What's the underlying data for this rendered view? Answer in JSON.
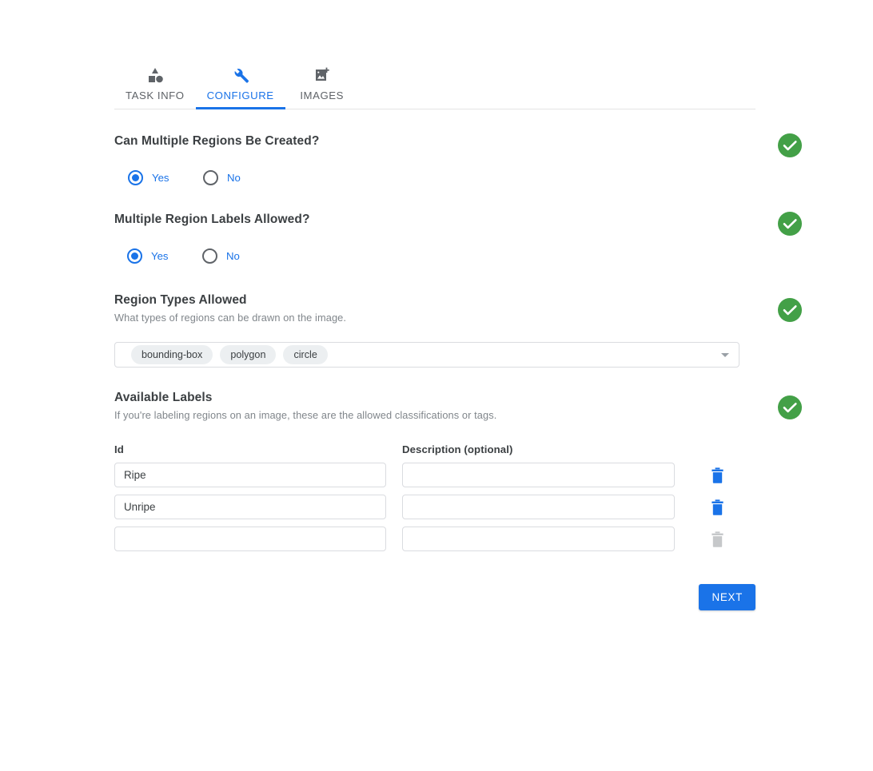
{
  "tabs": [
    {
      "label": "TASK INFO",
      "icon": "shapes-icon",
      "active": false
    },
    {
      "label": "CONFIGURE",
      "icon": "wrench-icon",
      "active": true
    },
    {
      "label": "IMAGES",
      "icon": "add-image-icon",
      "active": false
    }
  ],
  "colors": {
    "accent_blue": "#1a73e8",
    "valid_green": "#43a047",
    "chip_gray": "#eceff1",
    "border_gray": "#dadce0",
    "text_primary": "#3c4043",
    "text_muted": "#80868b"
  },
  "sections": {
    "multiple_regions": {
      "title": "Can Multiple Regions Be Created?",
      "valid": true,
      "options": [
        {
          "label": "Yes",
          "checked": true
        },
        {
          "label": "No",
          "checked": false
        }
      ]
    },
    "multiple_labels": {
      "title": "Multiple Region Labels Allowed?",
      "valid": true,
      "options": [
        {
          "label": "Yes",
          "checked": true
        },
        {
          "label": "No",
          "checked": false
        }
      ]
    },
    "region_types": {
      "title": "Region Types Allowed",
      "help": "What types of regions can be drawn on the image.",
      "valid": true,
      "chips": [
        "bounding-box",
        "polygon",
        "circle"
      ],
      "dropdown_icon": "chevron-down-icon"
    },
    "available_labels": {
      "title": "Available Labels",
      "help": "If you're labeling regions on an image, these are the allowed classifications or tags.",
      "valid": true,
      "columns": {
        "id": "Id",
        "description": "Description (optional)"
      },
      "rows": [
        {
          "id": "Ripe",
          "description": "",
          "delete_enabled": true
        },
        {
          "id": "Unripe",
          "description": "",
          "delete_enabled": true
        },
        {
          "id": "",
          "description": "",
          "delete_enabled": false
        }
      ],
      "id_placeholder": "",
      "description_placeholder": "",
      "delete_icon": "trash-icon"
    }
  },
  "footer": {
    "next_label": "NEXT"
  }
}
